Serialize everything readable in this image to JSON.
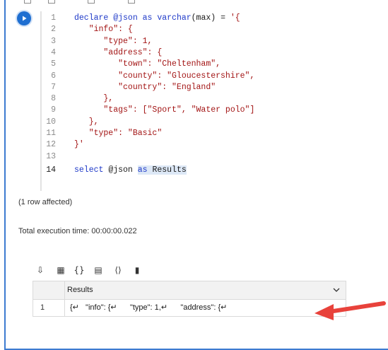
{
  "toolbar_top": {
    "icons": [
      "add-icon",
      "link-icon",
      "copy-icon",
      "delete-icon"
    ]
  },
  "run_button": {
    "icon": "play-icon"
  },
  "code": {
    "lines": [
      {
        "num": "1",
        "segments": [
          {
            "t": "declare @json ",
            "c": "kw"
          },
          {
            "t": "as ",
            "c": "kw"
          },
          {
            "t": "varchar",
            "c": "kw"
          },
          {
            "t": "(max) = ",
            "c": "plain"
          },
          {
            "t": "'{",
            "c": "str"
          }
        ]
      },
      {
        "num": "2",
        "segments": [
          {
            "t": "   \"info\": {",
            "c": "str"
          }
        ]
      },
      {
        "num": "3",
        "segments": [
          {
            "t": "      \"type\": 1,",
            "c": "str"
          }
        ]
      },
      {
        "num": "4",
        "segments": [
          {
            "t": "      \"address\": {",
            "c": "str"
          }
        ]
      },
      {
        "num": "5",
        "segments": [
          {
            "t": "         \"town\": \"Cheltenham\",",
            "c": "str"
          }
        ]
      },
      {
        "num": "6",
        "segments": [
          {
            "t": "         \"county\": \"Gloucestershire\",",
            "c": "str"
          }
        ]
      },
      {
        "num": "7",
        "segments": [
          {
            "t": "         \"country\": \"England\"",
            "c": "str"
          }
        ]
      },
      {
        "num": "8",
        "segments": [
          {
            "t": "      },",
            "c": "str"
          }
        ]
      },
      {
        "num": "9",
        "segments": [
          {
            "t": "      \"tags\": [\"Sport\", \"Water polo\"]",
            "c": "str"
          }
        ]
      },
      {
        "num": "10",
        "segments": [
          {
            "t": "   },",
            "c": "str"
          }
        ]
      },
      {
        "num": "11",
        "segments": [
          {
            "t": "   \"type\": \"Basic\"",
            "c": "str"
          }
        ]
      },
      {
        "num": "12",
        "segments": [
          {
            "t": "}'",
            "c": "str"
          }
        ]
      },
      {
        "num": "13",
        "segments": []
      },
      {
        "num": "14",
        "segments": [
          {
            "t": "select ",
            "c": "kw"
          },
          {
            "t": "@json ",
            "c": "plain"
          },
          {
            "t": "as ",
            "c": "kw sel"
          },
          {
            "t": "Results",
            "c": "plain sel"
          }
        ]
      }
    ],
    "active_line": "14"
  },
  "messages": {
    "rows_affected": "(1 row affected)",
    "execution_time": "Total execution time: 00:00:00.022"
  },
  "results_toolbar": {
    "icons": [
      "save-csv-icon",
      "save-excel-icon",
      "save-json-icon",
      "save-xml-icon",
      "copy-code-icon",
      "chart-icon"
    ]
  },
  "grid": {
    "column": "Results",
    "rows": [
      {
        "num": "1",
        "value": "{↵   \"info\": {↵      \"type\": 1,↵      \"address\": {↵"
      }
    ]
  },
  "annotation": {
    "color": "#e8423b"
  }
}
